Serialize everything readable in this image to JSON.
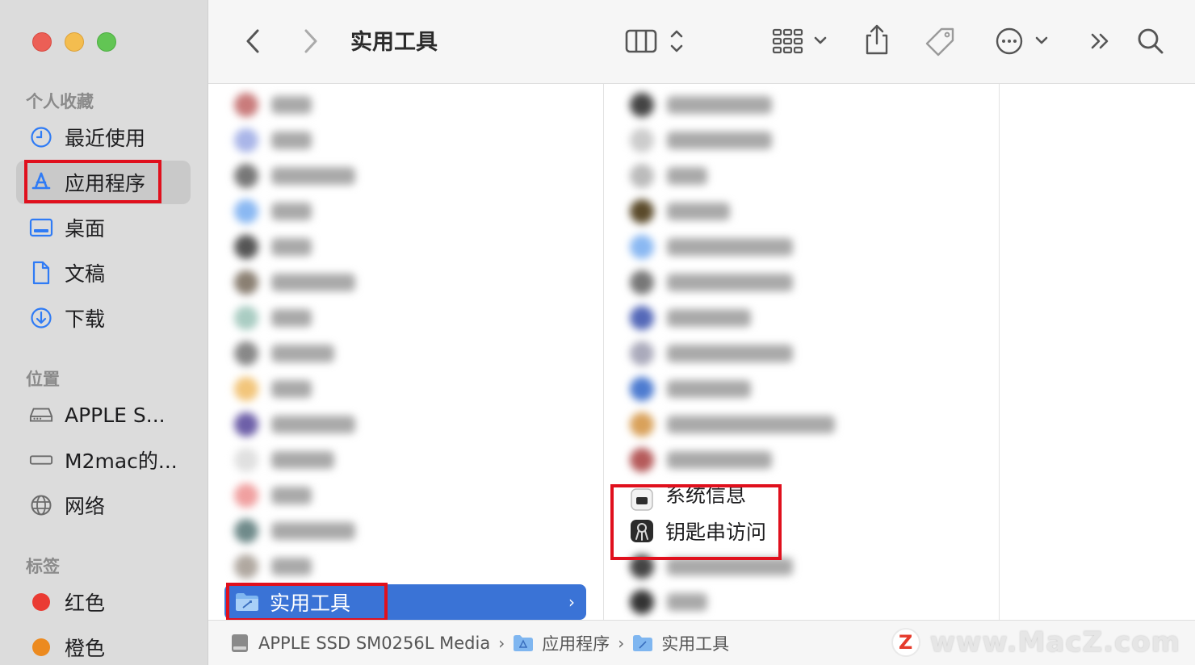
{
  "toolbar": {
    "title": "实用工具"
  },
  "sidebar": {
    "favorites_title": "个人收藏",
    "favorites": [
      {
        "label": "最近使用",
        "icon": "clock-icon"
      },
      {
        "label": "应用程序",
        "icon": "app-store-icon"
      },
      {
        "label": "桌面",
        "icon": "desktop-icon"
      },
      {
        "label": "文稿",
        "icon": "document-icon"
      },
      {
        "label": "下载",
        "icon": "download-icon"
      }
    ],
    "locations_title": "位置",
    "locations": [
      {
        "label": "APPLE S...",
        "icon": "drive-icon"
      },
      {
        "label": "M2mac的...",
        "icon": "drive-icon"
      },
      {
        "label": "网络",
        "icon": "globe-icon"
      }
    ],
    "tags_title": "标签",
    "tags": [
      {
        "label": "红色",
        "color": "#ea3b33"
      },
      {
        "label": "橙色",
        "color": "#ec8a1f"
      }
    ]
  },
  "column1": {
    "selected_item": "实用工具"
  },
  "column2": {
    "visible_items": [
      "系统信息",
      "钥匙串访问"
    ]
  },
  "pathbar": {
    "crumbs": [
      "APPLE SSD SM0256L Media",
      "应用程序",
      "实用工具"
    ]
  },
  "watermark": {
    "logo": "Z",
    "text": "www.MacZ.com"
  },
  "colors": {
    "selection": "#3a73d6",
    "highlight_box": "#e0101d",
    "accent": "#2f7bf5"
  }
}
